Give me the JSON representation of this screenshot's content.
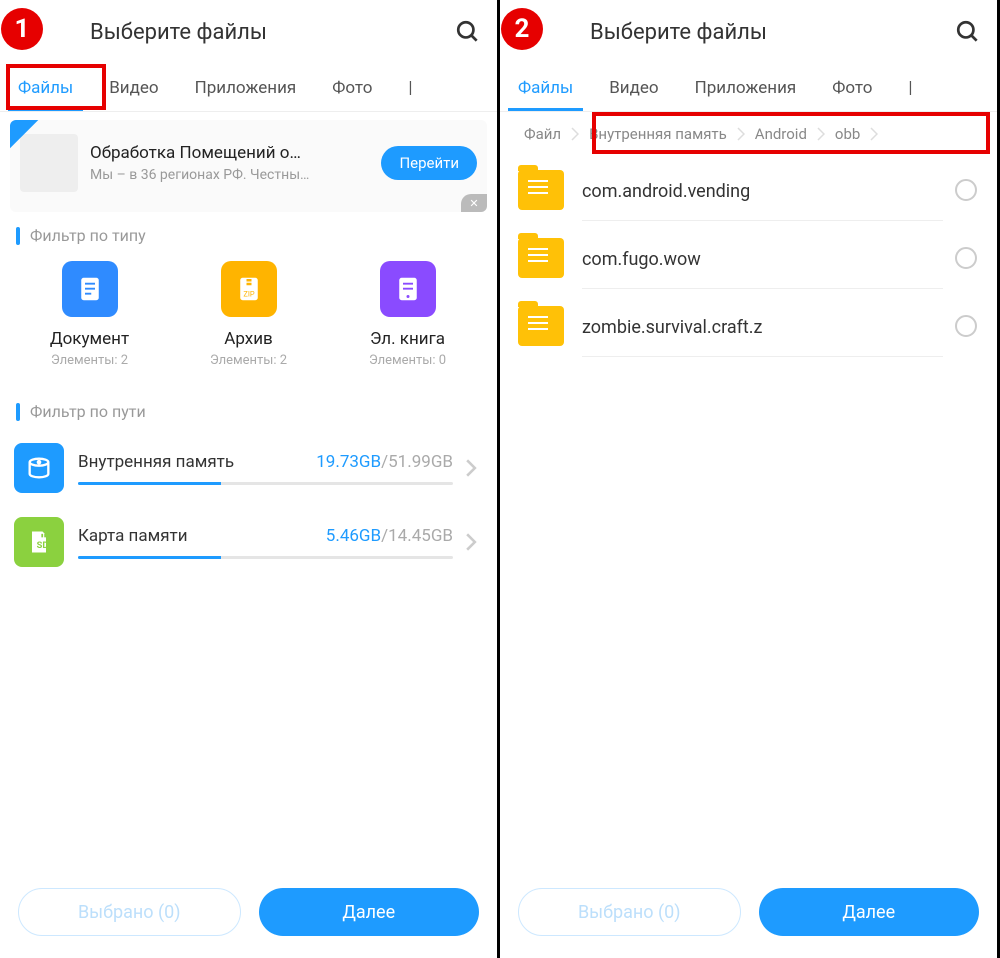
{
  "pane1": {
    "step": "1",
    "header": {
      "title": "Выберите файлы"
    },
    "tabs": [
      "Файлы",
      "Видео",
      "Приложения",
      "Фото"
    ],
    "ad": {
      "title": "Обработка Помещений о…",
      "sub": "Мы – в 36 регионах РФ. Честны…",
      "cta": "Перейти"
    },
    "section_type": "Фильтр по типу",
    "types": [
      {
        "label": "Документ",
        "count": "Элементы: 2"
      },
      {
        "label": "Архив",
        "count": "Элементы: 2"
      },
      {
        "label": "Эл. книга",
        "count": "Элементы: 0"
      }
    ],
    "section_path": "Фильтр по пути",
    "storage": [
      {
        "name": "Внутренняя память",
        "used": "19.73GB",
        "total": "/51.99GB",
        "pct": 38
      },
      {
        "name": "Карта памяти",
        "used": "5.46GB",
        "total": "/14.45GB",
        "pct": 38
      }
    ],
    "footer": {
      "selected": "Выбрано (0)",
      "next": "Далее"
    }
  },
  "pane2": {
    "step": "2",
    "header": {
      "title": "Выберите файлы"
    },
    "tabs": [
      "Файлы",
      "Видео",
      "Приложения",
      "Фото"
    ],
    "breadcrumb": [
      "Файл",
      "Внутренняя память",
      "Android",
      "obb"
    ],
    "folders": [
      "com.android.vending",
      "com.fugo.wow",
      "zombie.survival.craft.z"
    ],
    "footer": {
      "selected": "Выбрано (0)",
      "next": "Далее"
    }
  }
}
